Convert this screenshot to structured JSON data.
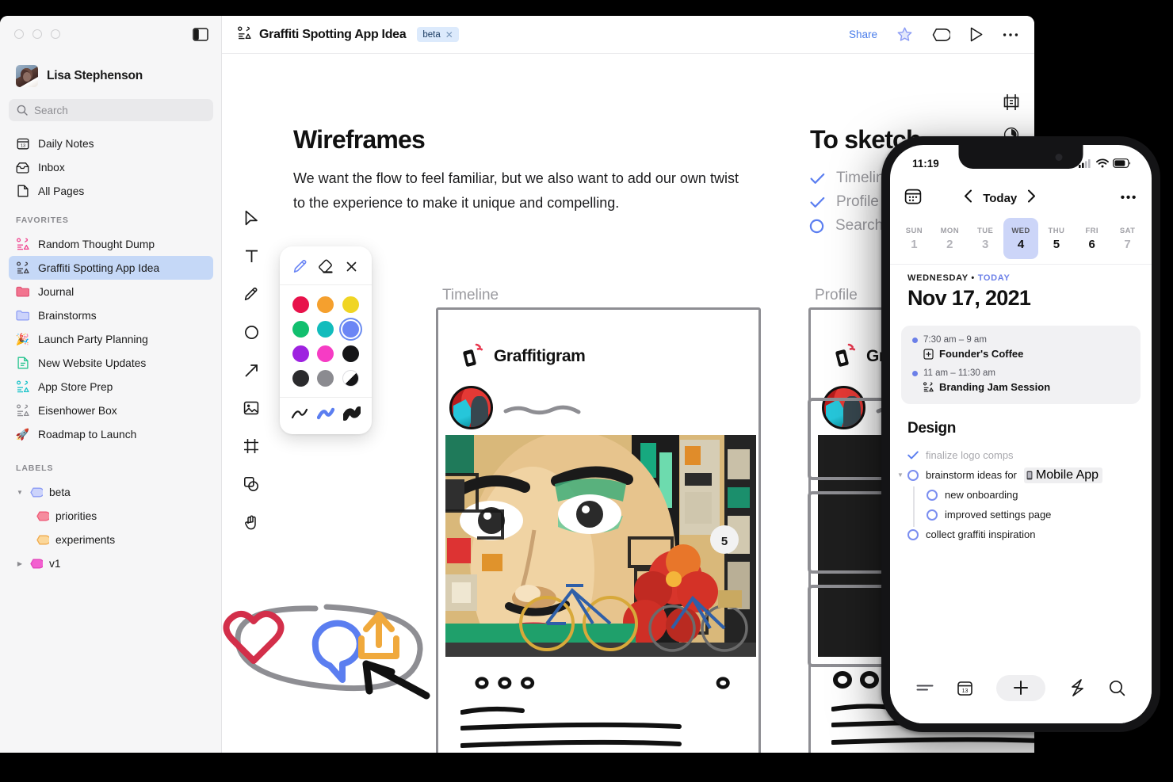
{
  "window": {
    "traffic_lights": [
      "close",
      "minimize",
      "maximize"
    ],
    "panel_toggle_icon": "sidebar-toggle-icon"
  },
  "sidebar": {
    "user": {
      "name": "Lisa Stephenson",
      "avatar_icon": "user-avatar"
    },
    "search": {
      "placeholder": "Search",
      "icon": "search-icon"
    },
    "nav": [
      {
        "label": "Daily Notes",
        "icon": "calendar-13-icon"
      },
      {
        "label": "Inbox",
        "icon": "inbox-icon"
      },
      {
        "label": "All Pages",
        "icon": "page-icon"
      }
    ],
    "favorites_heading": "FAVORITES",
    "favorites": [
      {
        "label": "Random Thought Dump",
        "icon": "outline-icon",
        "color": "#f0408c",
        "selected": false
      },
      {
        "label": "Graffiti Spotting App Idea",
        "icon": "outline-icon",
        "color": "#3c3c43",
        "selected": true
      },
      {
        "label": "Journal",
        "icon": "folder-icon",
        "color": "#f2748f",
        "selected": false
      },
      {
        "label": "Brainstorms",
        "icon": "folder-icon",
        "color": "#8c9cf5",
        "selected": false
      },
      {
        "label": "Launch Party Planning",
        "icon": "party-popper-icon",
        "color": "#f4a63a",
        "selected": false
      },
      {
        "label": "New Website Updates",
        "icon": "document-lines-icon",
        "color": "#24c38e",
        "selected": false
      },
      {
        "label": "App Store Prep",
        "icon": "outline-icon",
        "color": "#18c3c9",
        "selected": false
      },
      {
        "label": "Eisenhower Box",
        "icon": "outline-icon",
        "color": "#8e8e93",
        "selected": false
      },
      {
        "label": "Roadmap to Launch",
        "icon": "rocket-icon",
        "color": "#e8533a",
        "selected": false
      }
    ],
    "labels_heading": "LABELS",
    "labels": [
      {
        "label": "beta",
        "color": "#aab6f7",
        "expanded": true,
        "depth": 0
      },
      {
        "label": "priorities",
        "color": "#f0647e",
        "expanded": null,
        "depth": 1
      },
      {
        "label": "experiments",
        "color": "#f6b95c",
        "expanded": null,
        "depth": 1
      },
      {
        "label": "v1",
        "color": "#f35fd0",
        "expanded": false,
        "depth": 0
      }
    ]
  },
  "topbar": {
    "doc_icon": "outline-icon",
    "title": "Graffiti Spotting App Idea",
    "tag": {
      "label": "beta",
      "remove_icon": "close-icon"
    },
    "share_label": "Share",
    "actions": [
      {
        "name": "star-icon"
      },
      {
        "name": "tag-icon"
      },
      {
        "name": "play-icon"
      },
      {
        "name": "more-options-icon"
      }
    ]
  },
  "canvas": {
    "float_icons": [
      {
        "name": "frame-crop-icon"
      },
      {
        "name": "clock-icon"
      }
    ],
    "wireframes_heading": "Wireframes",
    "wireframes_body": "We want the flow to feel familiar, but we also want to add our own twist to the experience to make it unique and compelling.",
    "to_sketch_heading": "To sketch",
    "to_sketch_items": [
      {
        "label": "Timeline",
        "done": true
      },
      {
        "label": "Profile",
        "done": true
      },
      {
        "label": "Search",
        "done": false
      }
    ],
    "mock_labels": {
      "timeline": "Timeline",
      "profile": "Profile"
    },
    "mock_brand": "Graffitigram",
    "annotation_icons": [
      {
        "name": "heart-icon",
        "color": "#d32f4a"
      },
      {
        "name": "comment-icon",
        "color": "#5b7ef0"
      },
      {
        "name": "share-upload-icon",
        "color": "#f0a93c"
      }
    ],
    "annotation_shapes": [
      "lasso-circle",
      "arrow-up-left"
    ]
  },
  "tool_rail": [
    {
      "name": "cursor-select-icon"
    },
    {
      "name": "text-tool-icon"
    },
    {
      "name": "pen-tool-icon"
    },
    {
      "name": "ellipse-tool-icon"
    },
    {
      "name": "arrow-tool-icon"
    },
    {
      "name": "image-tool-icon"
    },
    {
      "name": "frame-tool-icon"
    },
    {
      "name": "shapes-tool-icon"
    },
    {
      "name": "hand-tool-icon"
    }
  ],
  "pen_popover": {
    "modes": [
      {
        "name": "pencil-icon",
        "active": true
      },
      {
        "name": "eraser-icon",
        "active": false
      },
      {
        "name": "close-icon",
        "active": false
      }
    ],
    "colors": [
      {
        "hex": "#e8124b",
        "selected": false
      },
      {
        "hex": "#f5a02e",
        "selected": false
      },
      {
        "hex": "#f0d524",
        "selected": false
      },
      {
        "hex": "#11bf6e",
        "selected": false
      },
      {
        "hex": "#12bcbc",
        "selected": false
      },
      {
        "hex": "#6b86f5",
        "selected": true
      },
      {
        "hex": "#9e22e0",
        "selected": false
      },
      {
        "hex": "#f63cc4",
        "selected": false
      },
      {
        "hex": "#151517",
        "selected": false
      },
      {
        "hex": "#2b2b2d",
        "selected": false
      },
      {
        "hex": "#8b8b90",
        "selected": false
      },
      {
        "hex": "#ffffff",
        "selected": false
      }
    ],
    "strokes": [
      {
        "name": "thin-stroke-icon",
        "color": "#1a1a1a"
      },
      {
        "name": "medium-stroke-icon",
        "color": "#5b7ef0"
      },
      {
        "name": "thick-stroke-icon",
        "color": "#1a1a1a"
      }
    ]
  },
  "phone": {
    "status": {
      "time": "11:19",
      "cellular_icon": "signal-icon",
      "wifi_icon": "wifi-icon",
      "battery_icon": "battery-icon"
    },
    "nav": {
      "calendar_icon": "calendar-picker-icon",
      "prev_icon": "chevron-left-icon",
      "title": "Today",
      "next_icon": "chevron-right-icon",
      "more_icon": "more-options-icon"
    },
    "week": [
      {
        "dow": "SUN",
        "num": "1",
        "active": false,
        "bold": false
      },
      {
        "dow": "MON",
        "num": "2",
        "active": false,
        "bold": false
      },
      {
        "dow": "TUE",
        "num": "3",
        "active": false,
        "bold": false
      },
      {
        "dow": "WED",
        "num": "4",
        "active": true,
        "bold": true
      },
      {
        "dow": "THU",
        "num": "5",
        "active": false,
        "bold": true
      },
      {
        "dow": "FRI",
        "num": "6",
        "active": false,
        "bold": true
      },
      {
        "dow": "SAT",
        "num": "7",
        "active": false,
        "bold": false
      }
    ],
    "date_kicker_day": "WEDNESDAY",
    "date_kicker_sep": " • ",
    "date_kicker_today": "TODAY",
    "date_big": "Nov 17, 2021",
    "events": [
      {
        "time": "7:30 am – 9 am",
        "name": "Founder's Coffee",
        "icon": "document-plus-icon"
      },
      {
        "time": "11 am – 11:30 am",
        "name": "Branding Jam Session",
        "icon": "outline-icon"
      }
    ],
    "design_heading": "Design",
    "tasks": [
      {
        "text": "finalize logo comps",
        "done": true,
        "sub": false,
        "mention": null
      },
      {
        "text": "brainstorm ideas for",
        "done": false,
        "sub": false,
        "mention": "Mobile App",
        "mention_icon": "mobile-icon",
        "has_caret": true
      },
      {
        "text": "new onboarding",
        "done": false,
        "sub": true,
        "mention": null
      },
      {
        "text": "improved settings page",
        "done": false,
        "sub": true,
        "mention": null
      },
      {
        "text": "collect graffiti inspiration",
        "done": false,
        "sub": false,
        "mention": null
      }
    ],
    "tabbar": [
      {
        "name": "list-lines-icon"
      },
      {
        "name": "calendar-13-icon"
      },
      {
        "name": "add-plus-icon"
      },
      {
        "name": "lightning-scribble-icon"
      },
      {
        "name": "search-icon"
      }
    ]
  }
}
